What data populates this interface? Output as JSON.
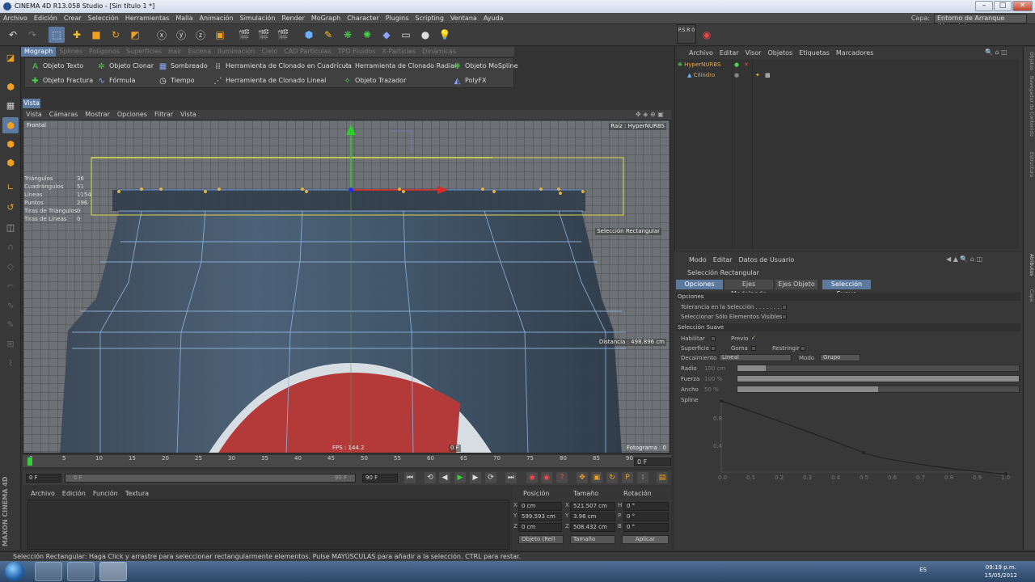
{
  "window": {
    "title": "CINEMA 4D R13.058 Studio - [Sin título 1 *]",
    "minimize": "–",
    "maximize": "□",
    "close": "✕"
  },
  "menu": [
    "Archivo",
    "Edición",
    "Crear",
    "Selección",
    "Herramientas",
    "Malla",
    "Animación",
    "Simulación",
    "Render",
    "MoGraph",
    "Character",
    "Plugins",
    "Scripting",
    "Ventana",
    "Ayuda"
  ],
  "layout": {
    "label": "Capa:",
    "value": "Entorno de Arranque (Usuario)"
  },
  "mograph": {
    "tabs": [
      "Mograph",
      "Splines",
      "Polígonos",
      "Superficies",
      "Hair",
      "Escena",
      "Iluminación",
      "Cielo",
      "CAD Partículas",
      "TPD Fluidos",
      "X-Particles",
      "Dinámicas"
    ],
    "active_tab": "Mograph",
    "row1": [
      "Objeto Texto",
      "Objeto Clonar",
      "Sombreado",
      "Herramienta de Clonado en Cuadrícula",
      "Herramienta de Clonado Radial",
      "Objeto MoSpline"
    ],
    "row2": [
      "Objeto Fractura",
      "Fórmula",
      "Tiempo",
      "Herramienta de Clonado Lineal",
      "Objeto Trazador",
      "PolyFX"
    ]
  },
  "viewport": {
    "tab": "Vista",
    "menu": [
      "Vista",
      "Cámaras",
      "Mostrar",
      "Opciones",
      "Filtrar",
      "Vista"
    ],
    "name": "Frontal",
    "raiz": "Raíz : HyperNURBS",
    "sel_label": "Selección Rectangular",
    "distance": "Distancia : 498.896 cm",
    "fps": "FPS : 144.2",
    "frame": "0 F",
    "fotograma": "Fotograma : 0",
    "stats": [
      {
        "label": "Triángulos",
        "value": "36"
      },
      {
        "label": "Cuadrángulos",
        "value": "51"
      },
      {
        "label": "Líneas",
        "value": "1154"
      },
      {
        "label": "Puntos",
        "value": "296"
      },
      {
        "label": "Tiras de Triángulos",
        "value": "0"
      },
      {
        "label": "Tiras de Líneas",
        "value": "0"
      }
    ]
  },
  "timeline": {
    "ticks": [
      "0",
      "5",
      "10",
      "15",
      "20",
      "25",
      "30",
      "35",
      "40",
      "45",
      "50",
      "55",
      "60",
      "65",
      "70",
      "75",
      "80",
      "85",
      "90"
    ],
    "current": "0 F",
    "start": "0 F",
    "min_f": "0 F",
    "max_f": "90 F",
    "end": "90 F"
  },
  "material": {
    "menu": [
      "Archivo",
      "Edición",
      "Función",
      "Textura"
    ]
  },
  "coords": {
    "headers": [
      "Posición",
      "Tamaño",
      "Rotación"
    ],
    "rows": [
      {
        "axis": "X",
        "pos": "0 cm",
        "size": "521.507 cm",
        "rlabel": "H",
        "rot": "0 °"
      },
      {
        "axis": "Y",
        "pos": "599.593 cm",
        "size": "3.96 cm",
        "rlabel": "P",
        "rot": "0 °"
      },
      {
        "axis": "Z",
        "pos": "0 cm",
        "size": "508.432 cm",
        "rlabel": "B",
        "rot": "0 °"
      }
    ],
    "mode": "Objeto (Rel)",
    "size_mode": "Tamaño",
    "apply": "Aplicar"
  },
  "objects": {
    "menu": [
      "Archivo",
      "Editar",
      "Visor",
      "Objetos",
      "Etiquetas",
      "Marcadores"
    ],
    "items": [
      {
        "name": "HyperNURBS",
        "color": "#e4a94a"
      },
      {
        "name": "Cilindro",
        "color": "#e4a94a"
      }
    ]
  },
  "right_tabs": [
    "Objetos",
    "Navegador de Contenido",
    "Estructura",
    "Atributos",
    "Capa"
  ],
  "attributes": {
    "menu": [
      "Modo",
      "Editar",
      "Datos de Usuario"
    ],
    "title": "Selección Rectangular",
    "tabs": [
      "Opciones",
      "Ejes Modelando",
      "Ejes Objeto",
      "Selección Suave"
    ],
    "section_options": "Opciones",
    "tolerance": "Tolerancia en la Selección . . . . . . . .",
    "visible_only": "Seleccionar Sólo Elementos Visibles",
    "section_soft": "Selección Suave",
    "habilitar": "Habilitar",
    "previo": "Previo",
    "superficie": "Superficie",
    "goma": "Goma",
    "restringir": "Restringir",
    "decaimiento_label": "Decaimiento",
    "decaimiento": "Lineal",
    "modo_label": "Modo",
    "modo": "Grupo",
    "radio_label": "Radio",
    "radio": "100 cm",
    "radio_fill": 0.1,
    "fuerza_label": "Fuerza",
    "fuerza": "100 %",
    "fuerza_fill": 1.0,
    "ancho_label": "Ancho",
    "ancho": "50 %",
    "ancho_fill": 0.5,
    "spline_label": "Spline",
    "spline_y_ticks": [
      "0.8",
      "0.4"
    ],
    "spline_x_ticks": [
      "0.0",
      "0.1",
      "0.2",
      "0.3",
      "0.4",
      "0.5",
      "0.6",
      "0.7",
      "0.8",
      "0.9",
      "1.0"
    ]
  },
  "status": "Selección Rectangular: Haga Click y arrastre para seleccionar rectangularmente elementos. Pulse MAYÚSCULAS para añadir a la selección. CTRL para restar.",
  "maxon": "MAXON CINEMA 4D",
  "taskbar": {
    "lang": "ES",
    "time": "09:19 p.m.",
    "date": "15/05/2012"
  },
  "psr": "P.S.R 0"
}
